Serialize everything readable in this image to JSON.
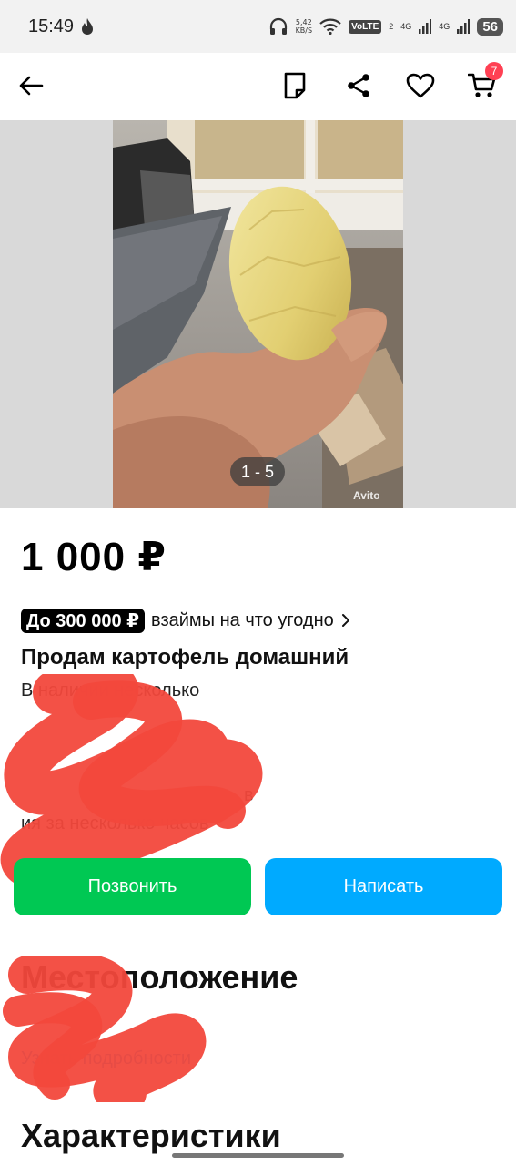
{
  "status_bar": {
    "time": "15:49",
    "net_speed_value": "5,42",
    "net_speed_unit": "KB/S",
    "volte": "VoLTE",
    "volte_sim": "2",
    "signal1": "4G",
    "signal2": "4G",
    "battery": "56"
  },
  "toolbar": {
    "cart_count": "7"
  },
  "gallery": {
    "counter": "1 - 5",
    "watermark": "Avito"
  },
  "listing": {
    "price": "1 000 ₽",
    "loan_badge": "До 300 000 ₽",
    "loan_text": "взаймы на что угодно",
    "title": "Продам картофель домашний",
    "description_line1": "В наличии несколько",
    "description_line2": "в",
    "description_line3": "ия за несколько часов"
  },
  "actions": {
    "call_label": "Позвонить",
    "message_label": "Написать"
  },
  "sections": {
    "location_title": "Местоположение",
    "location_link": "Узнать подробности",
    "characteristics_title": "Характеристики"
  },
  "colors": {
    "call_button": "#00c853",
    "message_button": "#00aaff",
    "cart_badge": "#ff4053",
    "link": "#0a8fe6",
    "redaction": "#f2483c"
  }
}
